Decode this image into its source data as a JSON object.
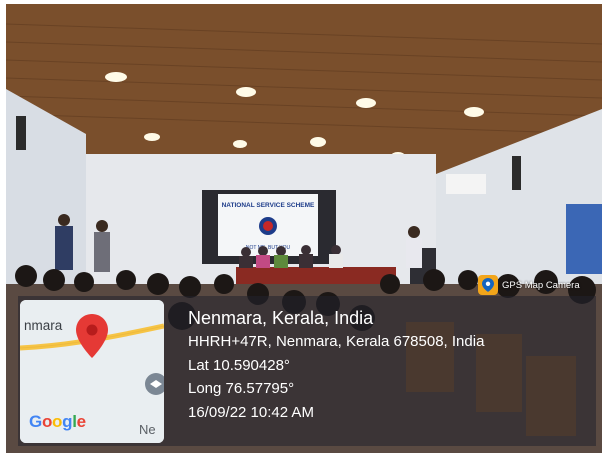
{
  "scene": {
    "banner": {
      "title": "NATIONAL SERVICE SCHEME",
      "motto": "NOT ME, BUT YOU"
    }
  },
  "gps_badge": {
    "label": "GPS Map Camera",
    "icon": "map-pin-icon",
    "color": "#f2a51a"
  },
  "map": {
    "town_label": "nmara",
    "second_label": "Ne",
    "google_letters": [
      "G",
      "o",
      "o",
      "g",
      "l",
      "e"
    ],
    "google_colors": [
      "#4285f4",
      "#ea4335",
      "#fbbc05",
      "#4285f4",
      "#34a853",
      "#ea4335"
    ],
    "pin_color": "#e53935",
    "road_color": "#f6c445"
  },
  "location": {
    "place": "Nenmara, Kerala, India",
    "address": "HHRH+47R, Nenmara, Kerala 678508, India",
    "lat": "Lat 10.590428°",
    "long": "Long 76.57795°",
    "datetime": "16/09/22 10:42 AM"
  }
}
